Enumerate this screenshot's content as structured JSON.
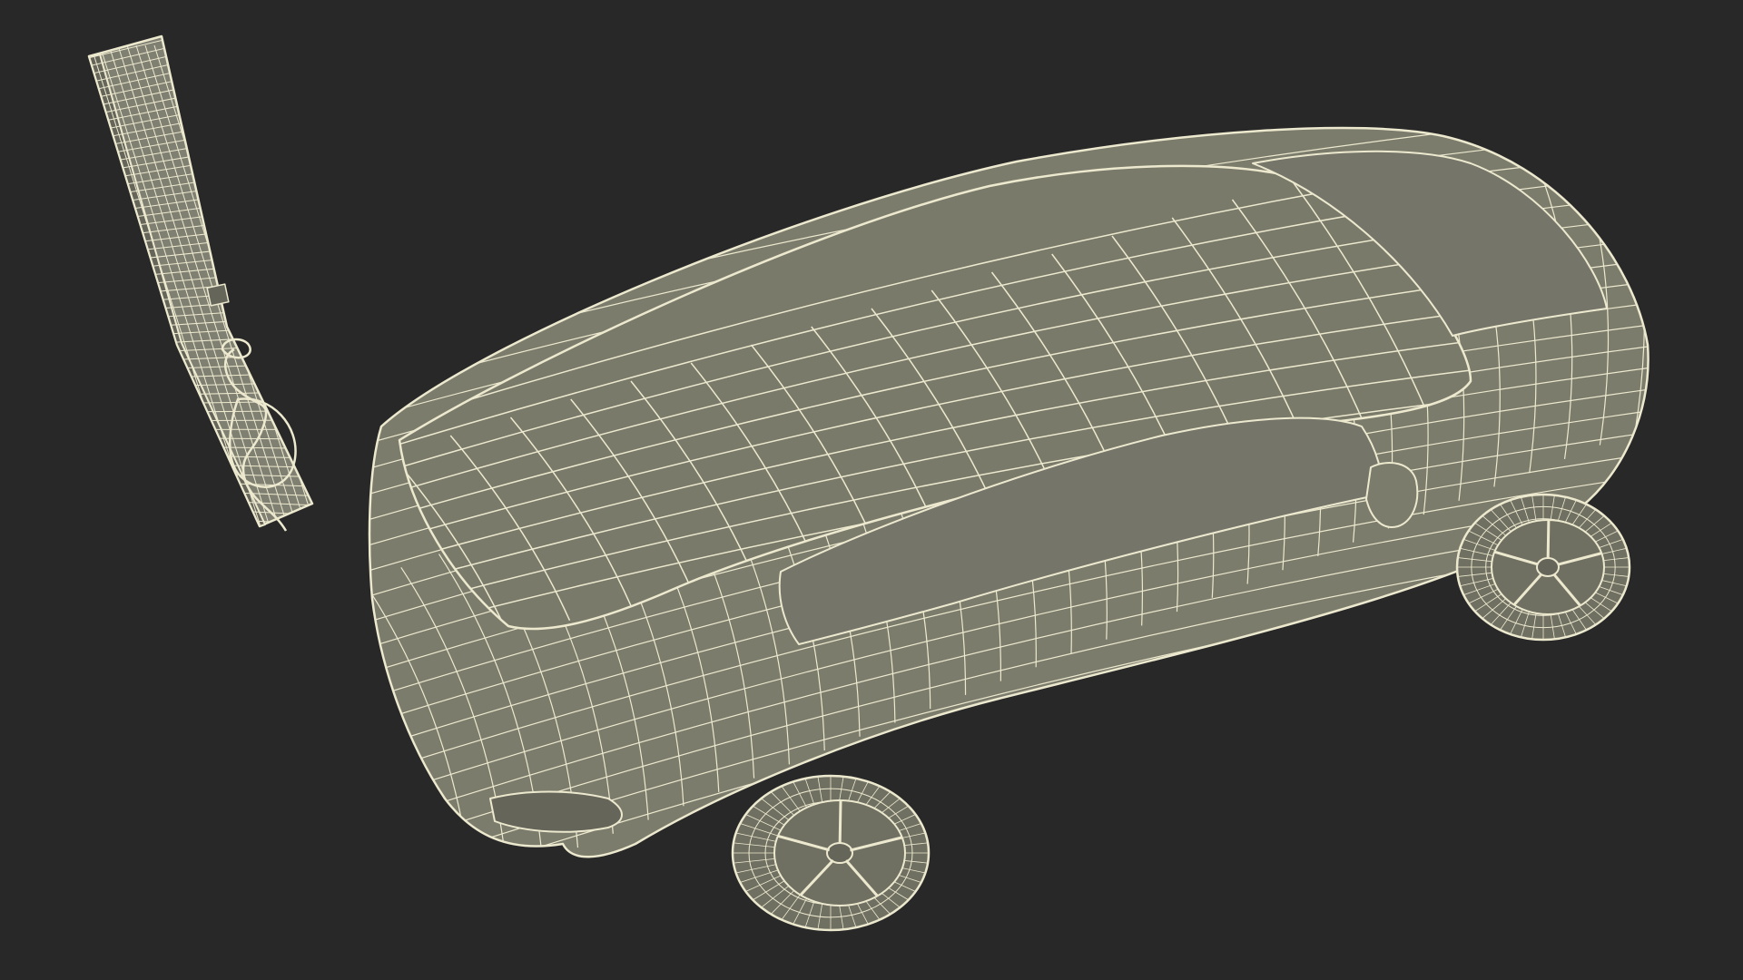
{
  "scene": {
    "background": "#282828",
    "wire_color": "#ece9cf",
    "body_fill": "#7c7c6c",
    "roof_fill": "#7a7a6a",
    "glass_fill": "#75756a",
    "wheel_fill": "#707062",
    "charger_fill": "#808072",
    "shade_fill": "#65655a",
    "objects": [
      {
        "name": "electric-car",
        "icon": "car-wireframe"
      },
      {
        "name": "wall-charger",
        "icon": "ev-charger-wireframe"
      }
    ]
  }
}
